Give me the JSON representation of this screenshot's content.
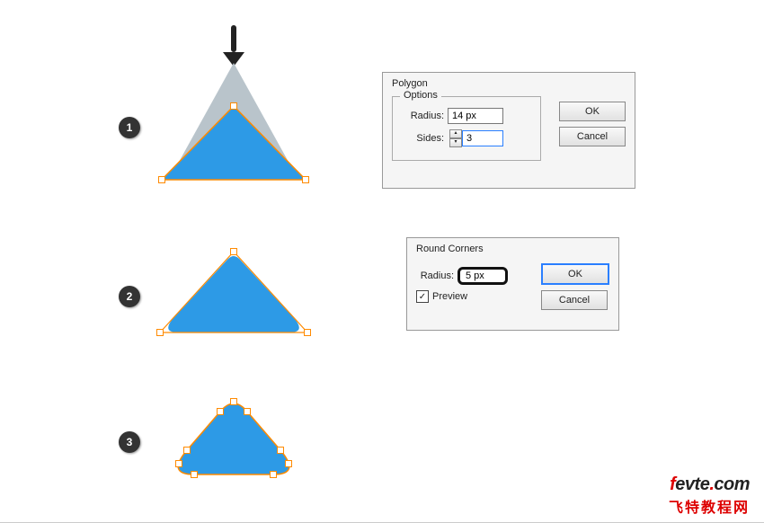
{
  "steps": {
    "s1": "1",
    "s2": "2",
    "s3": "3"
  },
  "polygon_dialog": {
    "title": "Polygon",
    "options_legend": "Options",
    "radius_label": "Radius:",
    "radius_value": "14 px",
    "sides_label": "Sides:",
    "sides_value": "3",
    "ok": "OK",
    "cancel": "Cancel"
  },
  "round_dialog": {
    "title": "Round Corners",
    "radius_label": "Radius:",
    "radius_value": "5 px",
    "preview_label": "Preview",
    "preview_checked": "✓",
    "ok": "OK",
    "cancel": "Cancel"
  },
  "logo": {
    "domain": "fevte.com",
    "cn": "飞特教程网"
  }
}
